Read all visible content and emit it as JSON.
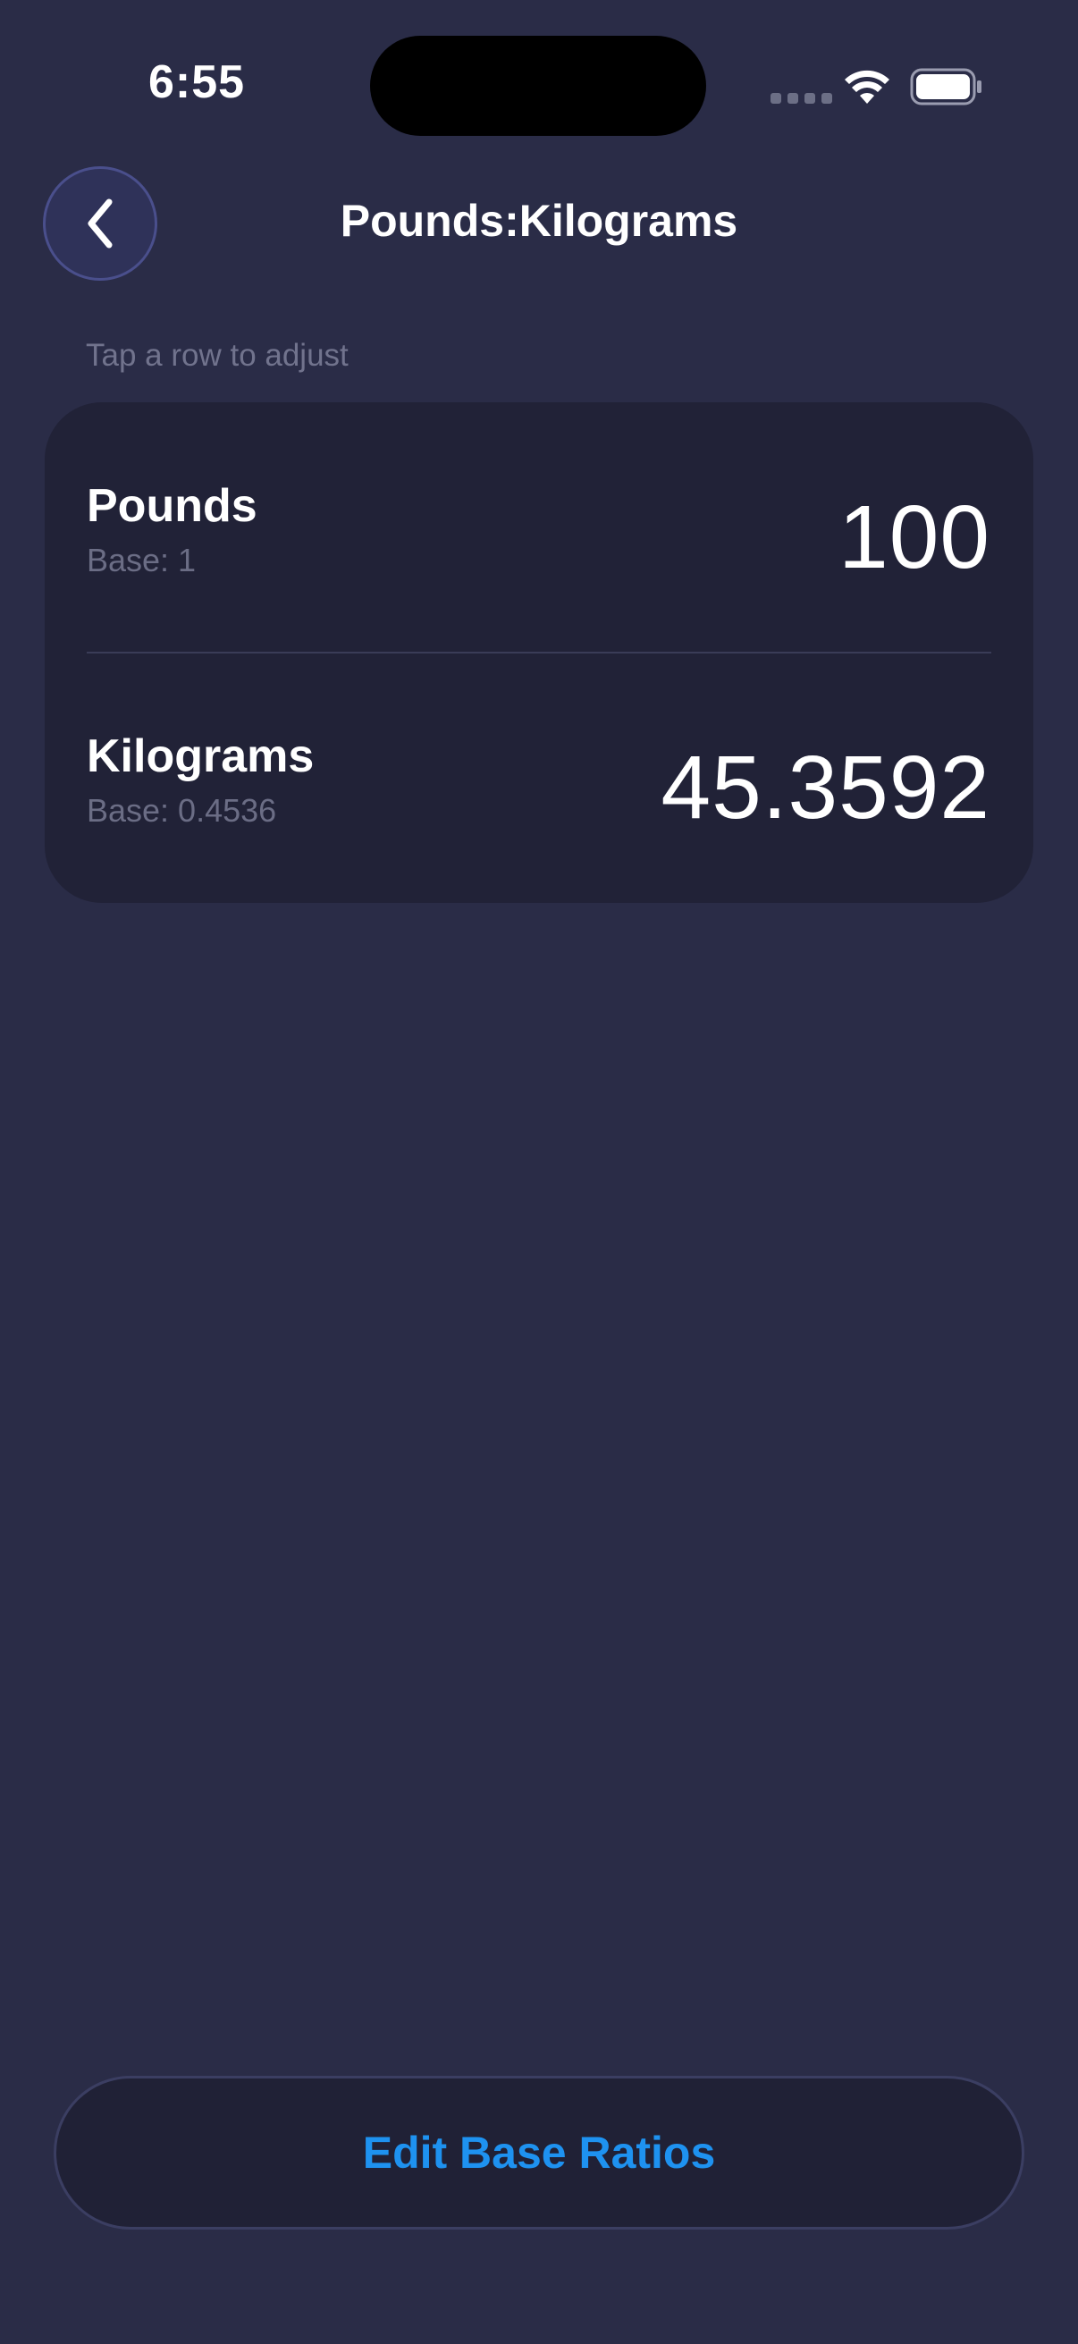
{
  "status_bar": {
    "time": "6:55"
  },
  "nav": {
    "title": "Pounds:Kilograms",
    "back_icon": "chevron-left-icon"
  },
  "hint": "Tap a row to adjust",
  "rows": [
    {
      "name": "Pounds",
      "base": "Base: 1",
      "value": "100"
    },
    {
      "name": "Kilograms",
      "base": "Base: 0.4536",
      "value": "45.3592"
    }
  ],
  "edit_button_label": "Edit Base Ratios",
  "colors": {
    "background": "#2a2c47",
    "card": "#212237",
    "accent": "#1e92f0"
  }
}
